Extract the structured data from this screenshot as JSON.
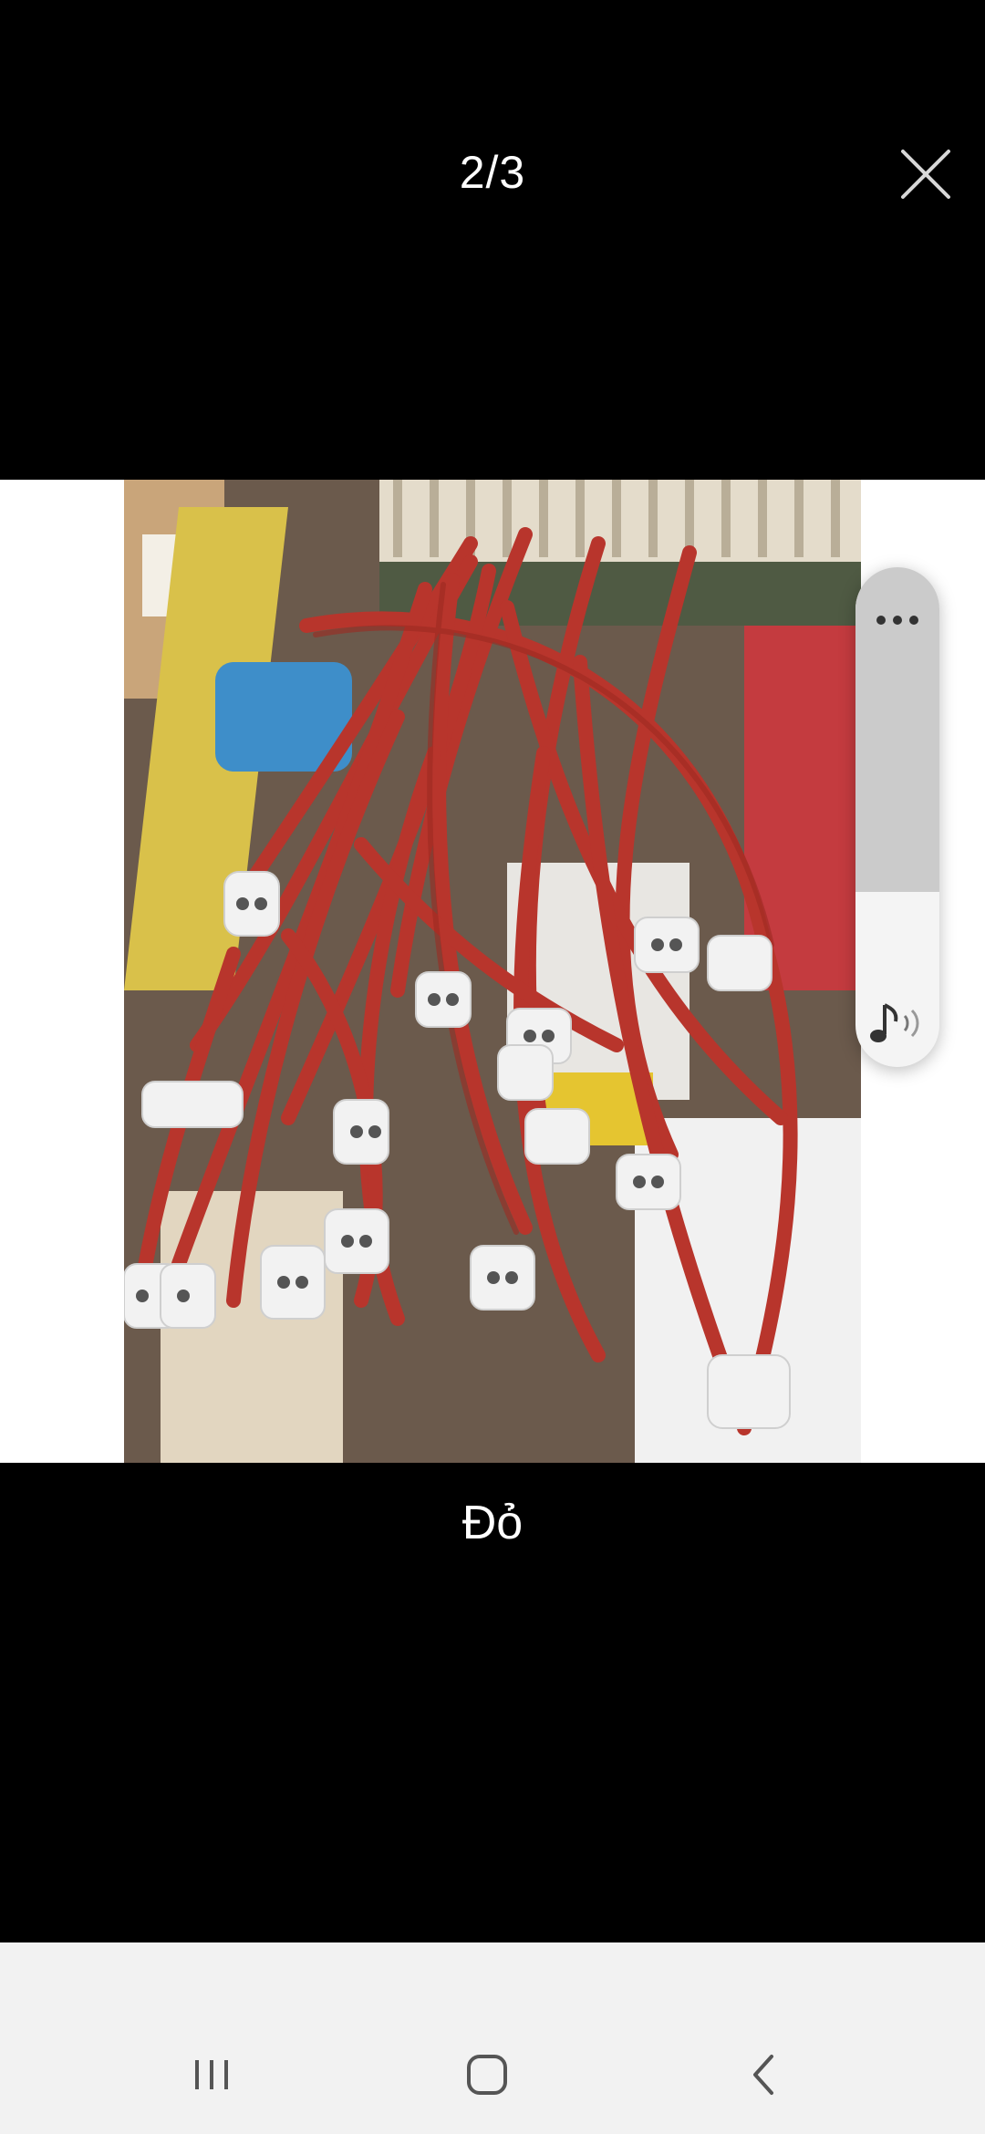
{
  "viewer": {
    "counter": "2/3",
    "caption": "Đỏ"
  },
  "icons": {
    "close": "close-icon",
    "more": "more-horizontal-icon",
    "sound": "music-sound-icon",
    "recents": "recents-icon",
    "home": "home-icon",
    "back": "back-icon"
  },
  "colors": {
    "background": "#000000",
    "navbar": "#f2f2f2",
    "panel_top": "#cbcbcb",
    "panel_bottom": "#f4f4f4",
    "cable_red": "#b8352c"
  }
}
